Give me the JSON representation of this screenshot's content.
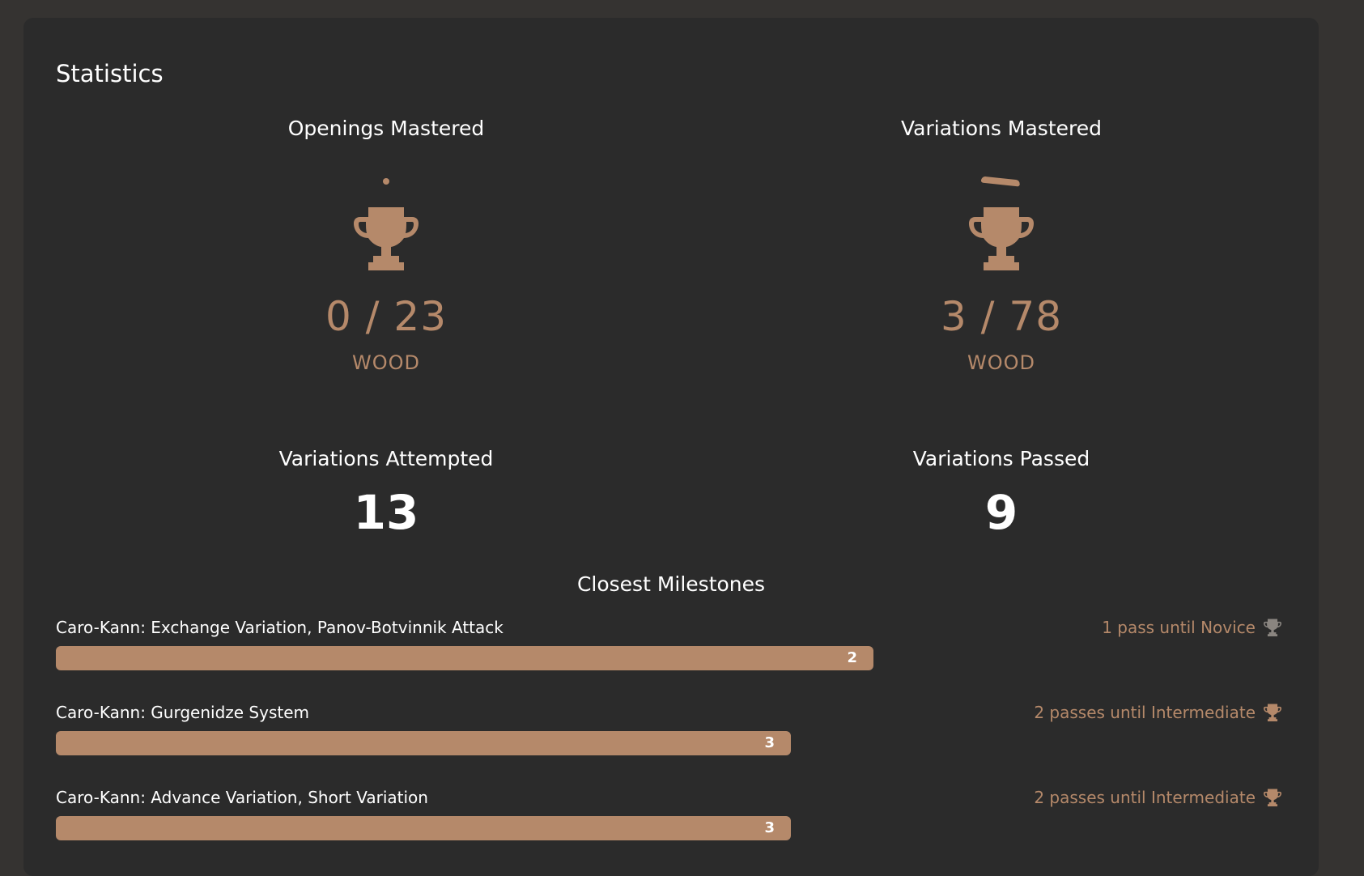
{
  "page_title": "Statistics",
  "colors": {
    "accent": "#b5896a",
    "card_bg": "#2b2b2b",
    "page_bg": "#353331",
    "text": "#ffffff"
  },
  "openings_mastered": {
    "label": "Openings Mastered",
    "ratio": "0 / 23",
    "tier": "WOOD",
    "icon": "trophy-icon"
  },
  "variations_mastered": {
    "label": "Variations Mastered",
    "ratio": "3 / 78",
    "tier": "WOOD",
    "icon": "trophy-icon"
  },
  "variations_attempted": {
    "label": "Variations Attempted",
    "value": "13"
  },
  "variations_passed": {
    "label": "Variations Passed",
    "value": "9"
  },
  "milestones": {
    "title": "Closest Milestones",
    "items": [
      {
        "name": "Caro-Kann: Exchange Variation, Panov-Botvinnik Attack",
        "count": "2",
        "goal": "1 pass until Novice",
        "progress": 0.667,
        "icon": "trophy-icon"
      },
      {
        "name": "Caro-Kann: Gurgenidze System",
        "count": "3",
        "goal": "2 passes until Intermediate",
        "progress": 0.6,
        "icon": "trophy-icon"
      },
      {
        "name": "Caro-Kann: Advance Variation, Short Variation",
        "count": "3",
        "goal": "2 passes until Intermediate",
        "progress": 0.6,
        "icon": "trophy-icon"
      }
    ]
  }
}
